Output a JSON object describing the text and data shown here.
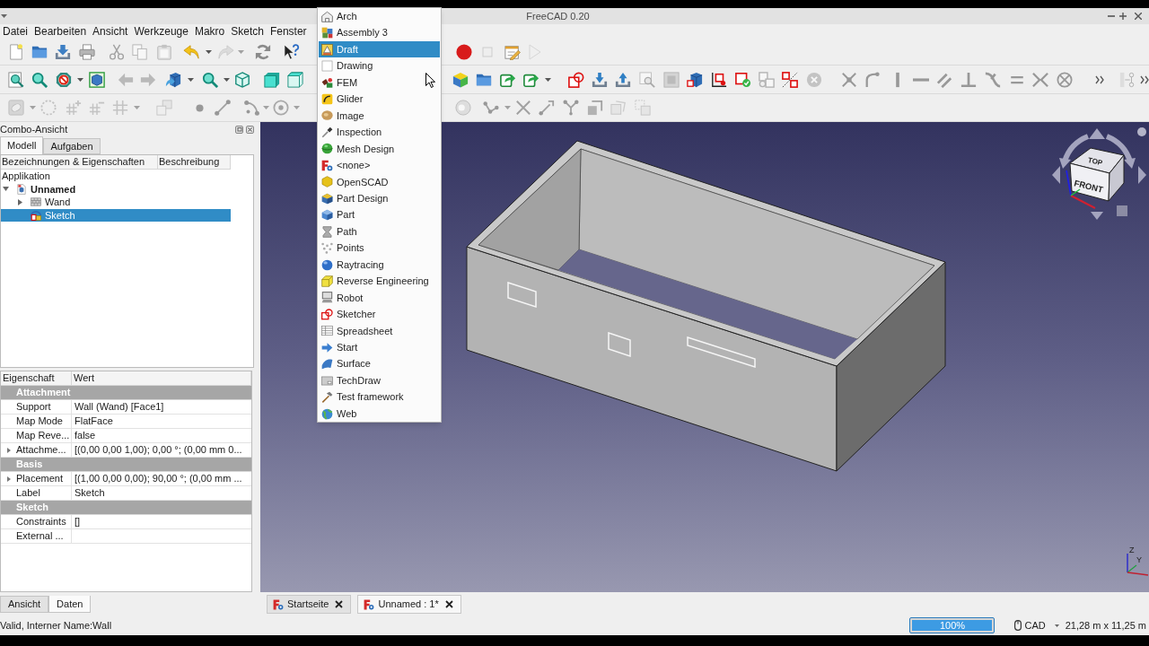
{
  "window": {
    "title": "FreeCAD 0.20"
  },
  "menu_bar": [
    "Datei",
    "Bearbeiten",
    "Ansicht",
    "Werkzeuge",
    "Makro",
    "Sketch",
    "Fenster"
  ],
  "toolbars": [
    {
      "items": [
        {
          "disabled": false
        },
        {
          "disabled": false
        },
        {
          "disabled": false
        },
        {
          "disabled": false
        },
        {
          "disabled": true
        },
        {
          "disabled": true
        },
        {
          "disabled": true
        },
        {
          "disabled": false
        },
        {
          "disabled": true
        },
        {
          "disabled": false
        },
        {
          "disabled": false
        },
        {
          "disabled": false
        },
        {
          "disabled": true
        },
        {
          "disabled": false
        },
        {
          "disabled": true
        }
      ]
    },
    {
      "items": [
        {
          "disabled": false
        },
        {
          "disabled": false
        },
        {
          "disabled": false
        },
        {
          "disabled": false
        },
        {
          "disabled": false
        },
        {
          "disabled": false
        },
        {
          "disabled": false
        },
        {
          "disabled": false
        },
        {
          "disabled": false
        },
        {
          "disabled": false
        },
        {
          "disabled": false
        },
        {
          "disabled": false
        },
        {
          "disabled": false
        },
        {
          "disabled": false
        },
        {
          "disabled": false
        },
        {
          "disabled": false
        },
        {
          "disabled": false
        },
        {
          "disabled": false
        },
        {
          "disabled": true
        },
        {
          "disabled": true
        },
        {
          "disabled": false
        },
        {
          "disabled": false
        },
        {
          "disabled": false
        },
        {
          "disabled": true
        },
        {
          "disabled": false
        },
        {
          "disabled": true
        },
        {
          "disabled": true
        },
        {
          "disabled": true
        },
        {
          "disabled": true
        },
        {
          "disabled": true
        },
        {
          "disabled": true
        },
        {
          "disabled": true
        },
        {
          "disabled": true
        },
        {
          "disabled": true
        },
        {
          "disabled": true
        },
        {
          "disabled": true
        },
        {
          "disabled": false
        },
        {
          "disabled": true
        },
        {
          "disabled": false
        }
      ]
    },
    {
      "items": [
        {
          "disabled": true
        },
        {
          "disabled": true
        },
        {
          "disabled": true
        },
        {
          "disabled": true
        },
        {
          "disabled": true
        },
        {
          "disabled": true
        },
        {
          "disabled": true
        },
        {
          "disabled": true
        },
        {
          "disabled": true
        },
        {
          "disabled": true
        },
        {
          "disabled": true
        },
        {
          "disabled": true
        },
        {
          "disabled": true
        },
        {
          "disabled": true
        },
        {
          "disabled": true
        },
        {
          "disabled": true
        },
        {
          "disabled": true
        },
        {
          "disabled": true
        }
      ]
    }
  ],
  "workbench_menu": {
    "items": [
      {
        "label": "Arch",
        "selected": false
      },
      {
        "label": "Assembly 3",
        "selected": false
      },
      {
        "label": "Draft",
        "selected": true
      },
      {
        "label": "Drawing",
        "selected": false
      },
      {
        "label": "FEM",
        "selected": false
      },
      {
        "label": "Glider",
        "selected": false
      },
      {
        "label": "Image",
        "selected": false
      },
      {
        "label": "Inspection",
        "selected": false
      },
      {
        "label": "Mesh Design",
        "selected": false
      },
      {
        "label": "<none>",
        "selected": false
      },
      {
        "label": "OpenSCAD",
        "selected": false
      },
      {
        "label": "Part Design",
        "selected": false
      },
      {
        "label": "Part",
        "selected": false
      },
      {
        "label": "Path",
        "selected": false
      },
      {
        "label": "Points",
        "selected": false
      },
      {
        "label": "Raytracing",
        "selected": false
      },
      {
        "label": "Reverse Engineering",
        "selected": false
      },
      {
        "label": "Robot",
        "selected": false
      },
      {
        "label": "Sketcher",
        "selected": false
      },
      {
        "label": "Spreadsheet",
        "selected": false
      },
      {
        "label": "Start",
        "selected": false
      },
      {
        "label": "Surface",
        "selected": false
      },
      {
        "label": "TechDraw",
        "selected": false
      },
      {
        "label": "Test framework",
        "selected": false
      },
      {
        "label": "Web",
        "selected": false
      }
    ]
  },
  "combo_view": {
    "title": "Combo-Ansicht",
    "tabs": [
      {
        "label": "Modell",
        "selected": true
      },
      {
        "label": "Aufgaben",
        "selected": false
      }
    ],
    "tree": {
      "columns": [
        "Bezeichnungen & Eigenschaften",
        "Beschreibung"
      ],
      "root": "Applikation",
      "items": [
        {
          "label": "Unnamed",
          "expanded": true,
          "selected": false,
          "children": [
            {
              "label": "Wand",
              "expanded": false,
              "selected": false
            },
            {
              "label": "Sketch",
              "selected": true
            }
          ]
        }
      ]
    },
    "property_view": {
      "columns": [
        "Eigenschaft",
        "Wert"
      ],
      "groups": [
        {
          "name": "Attachment",
          "rows": [
            {
              "name": "Support",
              "value": "Wall (Wand) [Face1]"
            },
            {
              "name": "Map Mode",
              "value": "FlatFace"
            },
            {
              "name": "Map Reve...",
              "value": "false"
            },
            {
              "name": "Attachme...",
              "value": "[(0,00 0,00 1,00); 0,00 °; (0,00 mm 0...",
              "expanded": false
            }
          ]
        },
        {
          "name": "Basis",
          "rows": [
            {
              "name": "Placement",
              "value": "[(1,00 0,00 0,00); 90,00 °; (0,00 mm ...",
              "expanded": false
            },
            {
              "name": "Label",
              "value": "Sketch"
            }
          ]
        },
        {
          "name": "Sketch",
          "rows": [
            {
              "name": "Constraints",
              "value": "[]"
            },
            {
              "name": "External ...",
              "value": ""
            }
          ]
        }
      ]
    },
    "bottom_tabs": [
      {
        "label": "Ansicht",
        "selected": false
      },
      {
        "label": "Daten",
        "selected": true
      }
    ]
  },
  "viewport": {
    "navigation_cube": {
      "faces": [
        "TOP",
        "FRONT"
      ]
    },
    "axis_labels": [
      "Z",
      "Y"
    ]
  },
  "document_tabs": [
    {
      "label": "Startseite",
      "selected": false
    },
    {
      "label": "Unnamed : 1*",
      "selected": true
    }
  ],
  "status_bar": {
    "message": "Valid, Interner Name:Wall",
    "progress": {
      "level": 1,
      "reading": "100%"
    },
    "navigation_style": "CAD",
    "dimensions": "21,28 m x 11,25 m"
  }
}
